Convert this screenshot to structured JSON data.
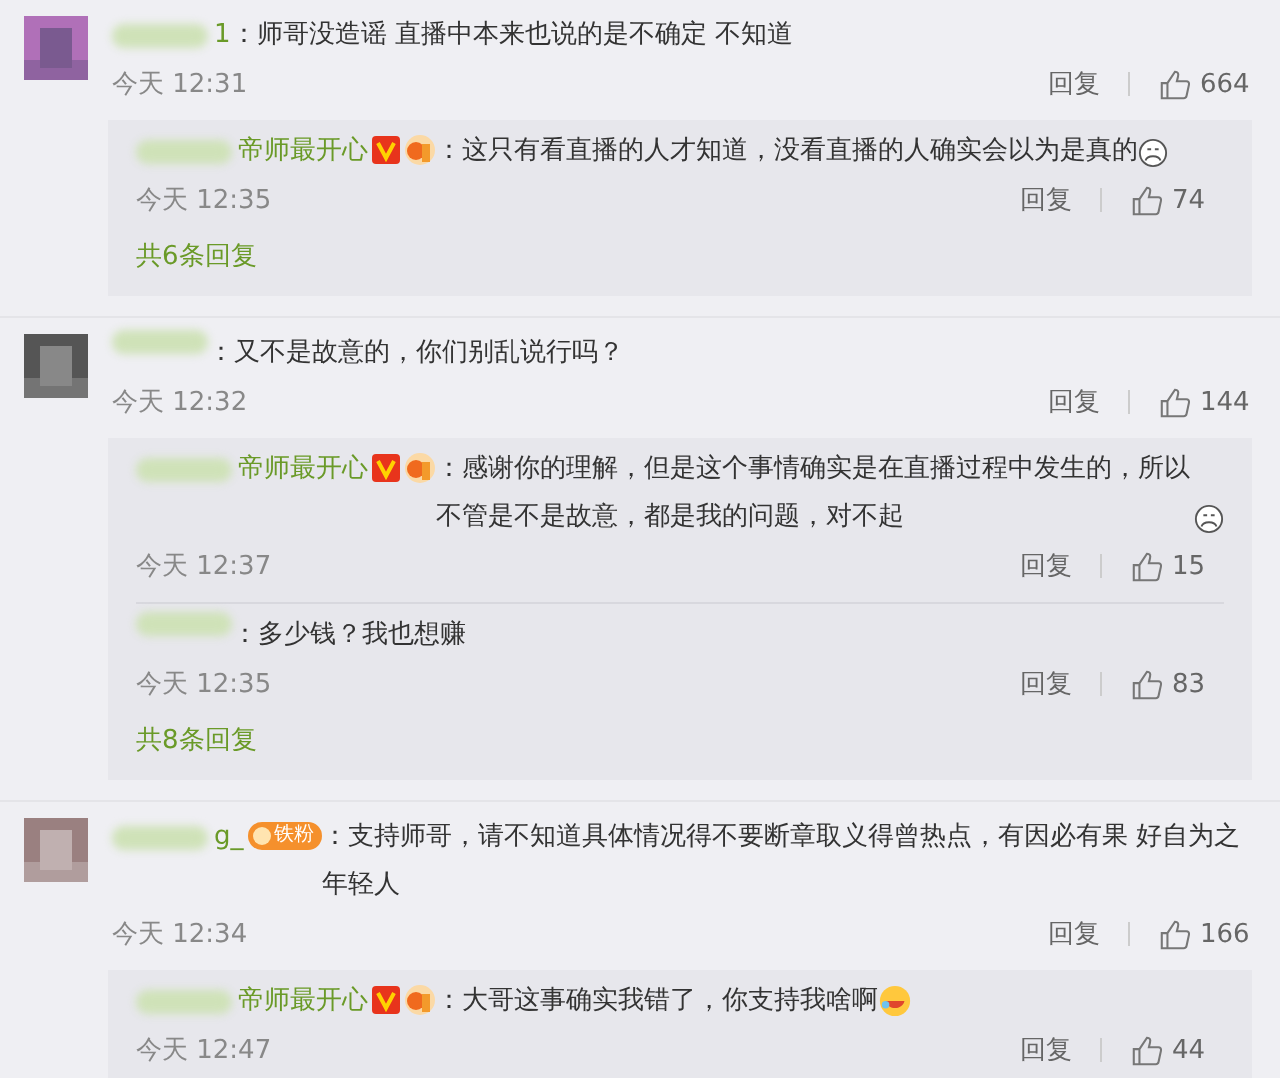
{
  "comments": [
    {
      "name": "1",
      "text": "：师哥没造谣 直播中本来也说的是不确定 不知道",
      "time": "今天 12:31",
      "reply_label": "回复",
      "likes": "664",
      "replies": [
        {
          "name": "帝师最开心",
          "badges": [
            {
              "kind": "verified"
            },
            {
              "kind": "level"
            }
          ],
          "text": "：这只有看直播的人才知道，没看直播的人确实会以为是真的",
          "emoji": {
            "kind": "sad"
          },
          "time": "今天 12:35",
          "reply_label": "回复",
          "likes": "74"
        }
      ],
      "more": "共6条回复"
    },
    {
      "text": "：又不是故意的，你们别乱说行吗？",
      "time": "今天 12:32",
      "reply_label": "回复",
      "likes": "144",
      "replies": [
        {
          "name": "帝师最开心",
          "badges": [
            {
              "kind": "verified"
            },
            {
              "kind": "level"
            }
          ],
          "text": "：感谢你的理解，但是这个事情确实是在直播过程中发生的，所以不管是不是故意，都是我的问题，对不起",
          "emoji": {
            "kind": "sad"
          },
          "time": "今天 12:37",
          "reply_label": "回复",
          "likes": "15"
        },
        {
          "text": "：多少钱？我也想赚",
          "time": "今天 12:35",
          "reply_label": "回复",
          "likes": "83"
        }
      ],
      "more": "共8条回复"
    },
    {
      "name": "g_",
      "text": "：支持师哥，请不知道具体情况得不要断章取义得曾热点，有因必有果 好自为之年轻人",
      "time": "今天 12:34",
      "reply_label": "回复",
      "likes": "166",
      "badges": [
        {
          "kind": "fan",
          "label": "铁粉"
        }
      ],
      "replies": [
        {
          "name": "帝师最开心",
          "badges": [
            {
              "kind": "verified"
            },
            {
              "kind": "level"
            }
          ],
          "text": "：大哥这事确实我错了，你支持我啥啊",
          "emoji": {
            "kind": "laugh"
          },
          "time": "今天 12:47",
          "reply_label": "回复",
          "likes": "44"
        }
      ]
    }
  ]
}
